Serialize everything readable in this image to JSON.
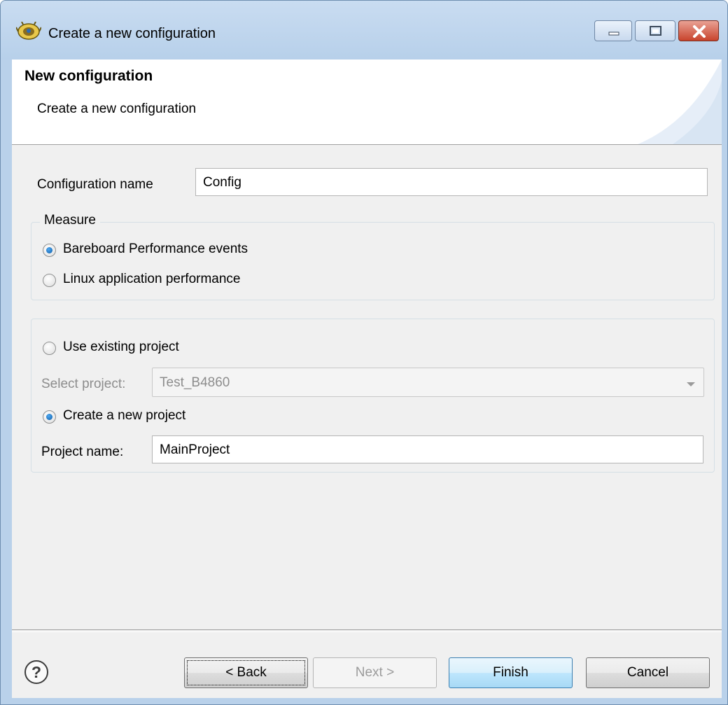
{
  "window": {
    "title": "Create a new configuration",
    "icon": "eclipse-wizard-icon"
  },
  "header": {
    "title": "New configuration",
    "description": "Create a new configuration"
  },
  "form": {
    "config_name_label": "Configuration name",
    "config_name_value": "Config",
    "measure": {
      "title": "Measure",
      "options": [
        {
          "label": "Bareboard Performance events",
          "checked": true
        },
        {
          "label": "Linux application performance",
          "checked": false
        }
      ]
    },
    "project": {
      "use_existing_label": "Use existing project",
      "use_existing_checked": false,
      "select_project_label": "Select project:",
      "select_project_value": "Test_B4860",
      "create_new_label": "Create a new project",
      "create_new_checked": true,
      "project_name_label": "Project name:",
      "project_name_value": "MainProject"
    }
  },
  "buttons": {
    "help": "?",
    "back": "< Back",
    "next": "Next >",
    "finish": "Finish",
    "cancel": "Cancel"
  }
}
